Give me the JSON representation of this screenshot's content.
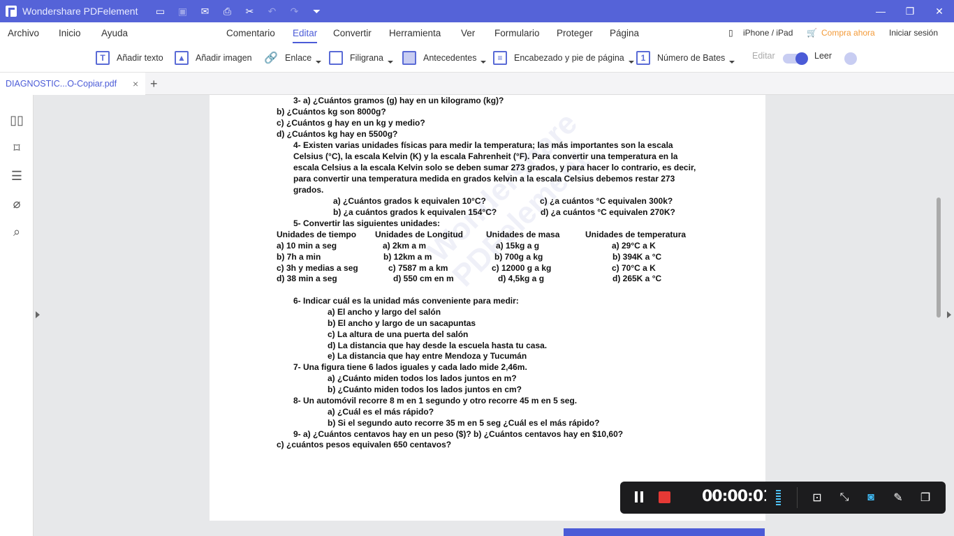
{
  "app": {
    "title": "Wondershare PDFelement"
  },
  "menu": {
    "left": [
      "Archivo",
      "Inicio",
      "Ayuda"
    ],
    "center": [
      "Comentario",
      "Editar",
      "Convertir",
      "Herramienta",
      "Ver",
      "Formulario",
      "Proteger",
      "Página"
    ],
    "active": "Editar",
    "device": "iPhone / iPad",
    "buy": "Compra ahora",
    "login": "Iniciar sesión"
  },
  "toolbar": {
    "add_text": "Añadir texto",
    "add_image": "Añadir imagen",
    "link": "Enlace",
    "watermark": "Filigrana",
    "background": "Antecedentes",
    "header_footer": "Encabezado y pie de página",
    "bates": "Número de Bates",
    "edit": "Editar",
    "read": "Leer"
  },
  "tab": {
    "name": "DIAGNOSTIC...O-Copiar.pdf",
    "close": "×",
    "add": "+"
  },
  "document": {
    "watermark": "Wondershare PDFelement",
    "lines": [
      "3-   a) ¿Cuántos gramos (g) hay en un kilogramo (kg)?",
      "b) ¿Cuántos kg son 8000g?",
      "c) ¿Cuántos g hay en un kg y medio?",
      "d) ¿Cuántos kg hay en 5500g?",
      "4-    Existen varias unidades físicas para medir la temperatura; las más importantes son la escala",
      "Celsius (°C), la escala Kelvin (K) y la escala Fahrenheit (°F). Para convertir una temperatura en la",
      "escala Celsius a la escala Kelvin solo se deben sumar 273 grados, y para hacer lo contrario, es decir,",
      "para convertir una temperatura medida en grados kelvin a la escala Celsius debemos restar 273",
      "grados.",
      "a)    ¿Cuántos grados k equivalen 10°C?",
      "c) ¿a cuántos °C equivalen 300k?",
      "b)    ¿a cuántos grados k equivalen 154°C?",
      "d) ¿a cuántos °C equivalen 270K?",
      "5-    Convertir las siguientes unidades:",
      "Unidades de tiempo",
      "Unidades de Longitud",
      "Unidades de masa",
      "Unidades de temperatura",
      "a)  10 min a seg",
      "a) 2km a m",
      "a) 15kg a g",
      "a) 29°C a K",
      "b)  7h a min",
      "b) 12km a m",
      "b) 700g a kg",
      "b) 394K a °C",
      "c)  3h y medias a seg",
      "c) 7587 m a km",
      "c) 12000 g a kg",
      "c) 70°C a K",
      "d)  38 min a seg",
      "d) 550 cm en m",
      "d) 4,5kg a g",
      "d) 265K a °C",
      "6-    Indicar cuál es la unidad más conveniente para medir:",
      "a)    El ancho y largo del salón",
      "b)    El ancho y largo de un sacapuntas",
      "c)    La altura de una puerta del salón",
      "d)    La distancia que hay desde la escuela hasta tu casa.",
      "e)    La distancia que hay entre Mendoza y Tucumán",
      "7-    Una figura tiene 6 lados iguales y cada lado mide 2,46m.",
      "a)    ¿Cuánto miden todos los lados juntos en m?",
      "b)    ¿Cuánto miden todos los lados juntos en cm?",
      "8-    Un automóvil recorre 8 m en 1 segundo y otro recorre 45 m en 5 seg.",
      "a)    ¿Cuál es el más rápido?",
      "b)     Si el segundo auto recorre 35 m en 5 seg ¿Cuál es el más rápido?",
      "9-    a) ¿Cuántos centavos hay en un peso ($)?  b) ¿Cuántos centavos hay en $10,60?",
      "c) ¿cuántos pesos equivalen 650 centavos?"
    ]
  },
  "recorder": {
    "time": "00:00:01"
  }
}
